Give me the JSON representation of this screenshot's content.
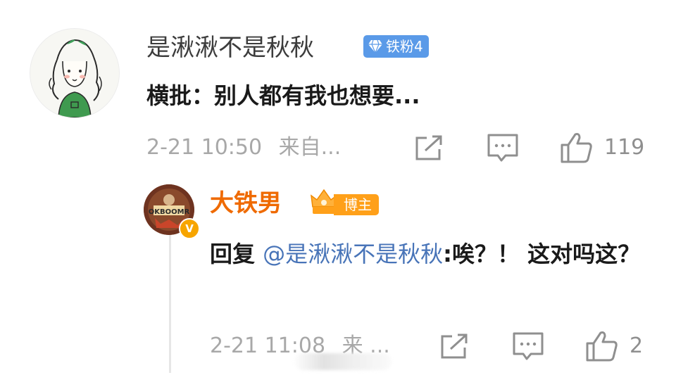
{
  "comment": {
    "username": "是湫湫不是秋秋",
    "badge": {
      "label": "铁粉4",
      "icon": "diamond-icon",
      "color": "#5a9ae8"
    },
    "text": "横批：别人都有我也想要...",
    "time": "2-21 10:50",
    "source": "来自...",
    "likes": "119"
  },
  "reply": {
    "username": "大铁男",
    "username_color": "#ef6a00",
    "badge": {
      "label": "博主",
      "icon": "crown-icon",
      "color": "#ffa019"
    },
    "verified_icon": "v-verified-icon",
    "text_prefix": "回复",
    "mention": "@是湫湫不是秋秋",
    "text_body": ":唉？！ 这对吗这？",
    "time": "2-21 11:08",
    "source": "来 ...",
    "likes": "2"
  },
  "actions": {
    "share_icon": "share-icon",
    "comment_icon": "comment-icon",
    "like_icon": "thumbs-up-icon"
  }
}
